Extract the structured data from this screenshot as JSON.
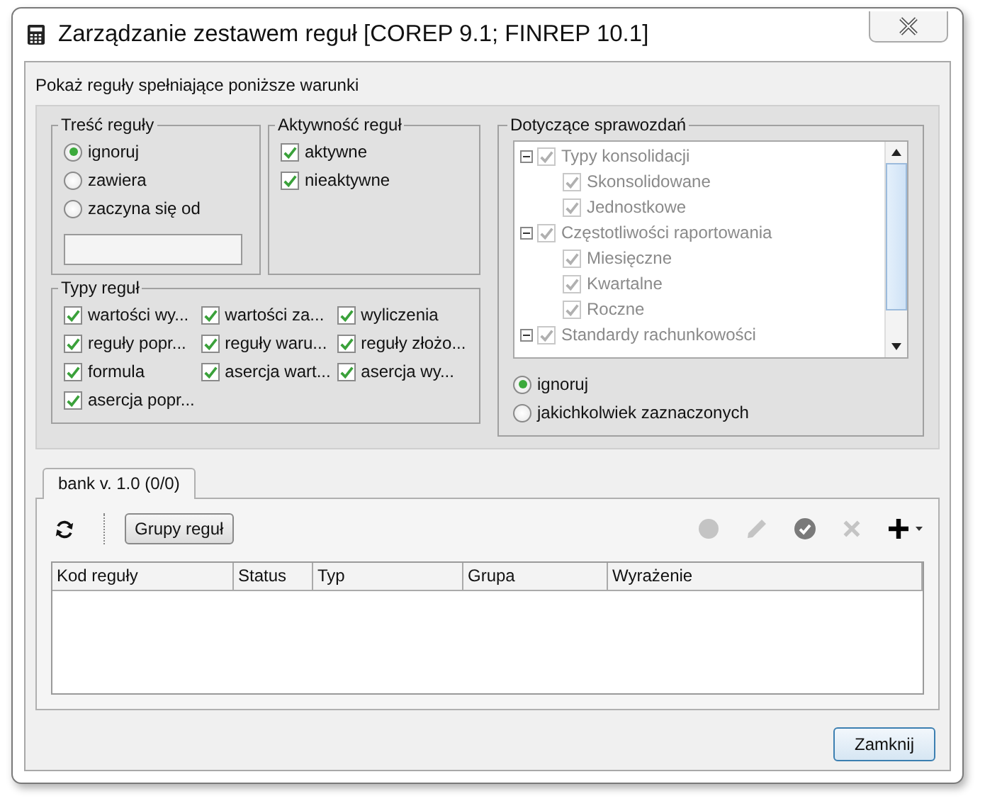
{
  "window": {
    "title": "Zarządzanie zestawem reguł [COREP 9.1; FINREP 10.1]"
  },
  "filter_panel": {
    "title": "Pokaż reguły spełniające poniższe warunki",
    "rule_content": {
      "title": "Treść reguły",
      "options": [
        {
          "label": "ignoruj",
          "selected": true
        },
        {
          "label": "zawiera",
          "selected": false
        },
        {
          "label": "zaczyna się od",
          "selected": false
        }
      ]
    },
    "rule_activity": {
      "title": "Aktywność reguł",
      "items": [
        {
          "label": "aktywne",
          "checked": true
        },
        {
          "label": "nieaktywne",
          "checked": true
        }
      ]
    },
    "rule_types": {
      "title": "Typy reguł",
      "items": [
        {
          "label": "wartości wy...",
          "checked": true
        },
        {
          "label": "wartości za...",
          "checked": true
        },
        {
          "label": "wyliczenia",
          "checked": true
        },
        {
          "label": "reguły popr...",
          "checked": true
        },
        {
          "label": "reguły waru...",
          "checked": true
        },
        {
          "label": "reguły złożo...",
          "checked": true
        },
        {
          "label": "formula",
          "checked": true
        },
        {
          "label": "asercja wart...",
          "checked": true
        },
        {
          "label": "asercja wy...",
          "checked": true
        },
        {
          "label": "asercja popr...",
          "checked": true
        }
      ]
    },
    "reports": {
      "title": "Dotyczące sprawozdań",
      "disabled": true,
      "tree": [
        {
          "label": "Typy konsolidacji",
          "checked": true,
          "expanded": true,
          "children": [
            {
              "label": "Skonsolidowane",
              "checked": true
            },
            {
              "label": "Jednostkowe",
              "checked": true
            }
          ]
        },
        {
          "label": "Częstotliwości raportowania",
          "checked": true,
          "expanded": true,
          "children": [
            {
              "label": "Miesięczne",
              "checked": true
            },
            {
              "label": "Kwartalne",
              "checked": true
            },
            {
              "label": "Roczne",
              "checked": true
            }
          ]
        },
        {
          "label": "Standardy rachunkowości",
          "checked": true,
          "expanded": true
        }
      ],
      "options": [
        {
          "label": "ignoruj",
          "selected": true
        },
        {
          "label": "jakichkolwiek zaznaczonych",
          "selected": false
        }
      ]
    }
  },
  "tabs": [
    {
      "label": "bank v. 1.0 (0/0)",
      "selected": true
    }
  ],
  "toolbar": {
    "group_button": "Grupy reguł",
    "actions": [
      {
        "kind": "record",
        "disabled": true
      },
      {
        "kind": "edit",
        "disabled": true
      },
      {
        "kind": "approve",
        "disabled": false
      },
      {
        "kind": "delete",
        "disabled": true
      },
      {
        "kind": "add",
        "disabled": false
      }
    ]
  },
  "table": {
    "columns": [
      "Kod reguły",
      "Status",
      "Typ",
      "Grupa",
      "Wyrażenie"
    ]
  },
  "close_button": "Zamknij"
}
